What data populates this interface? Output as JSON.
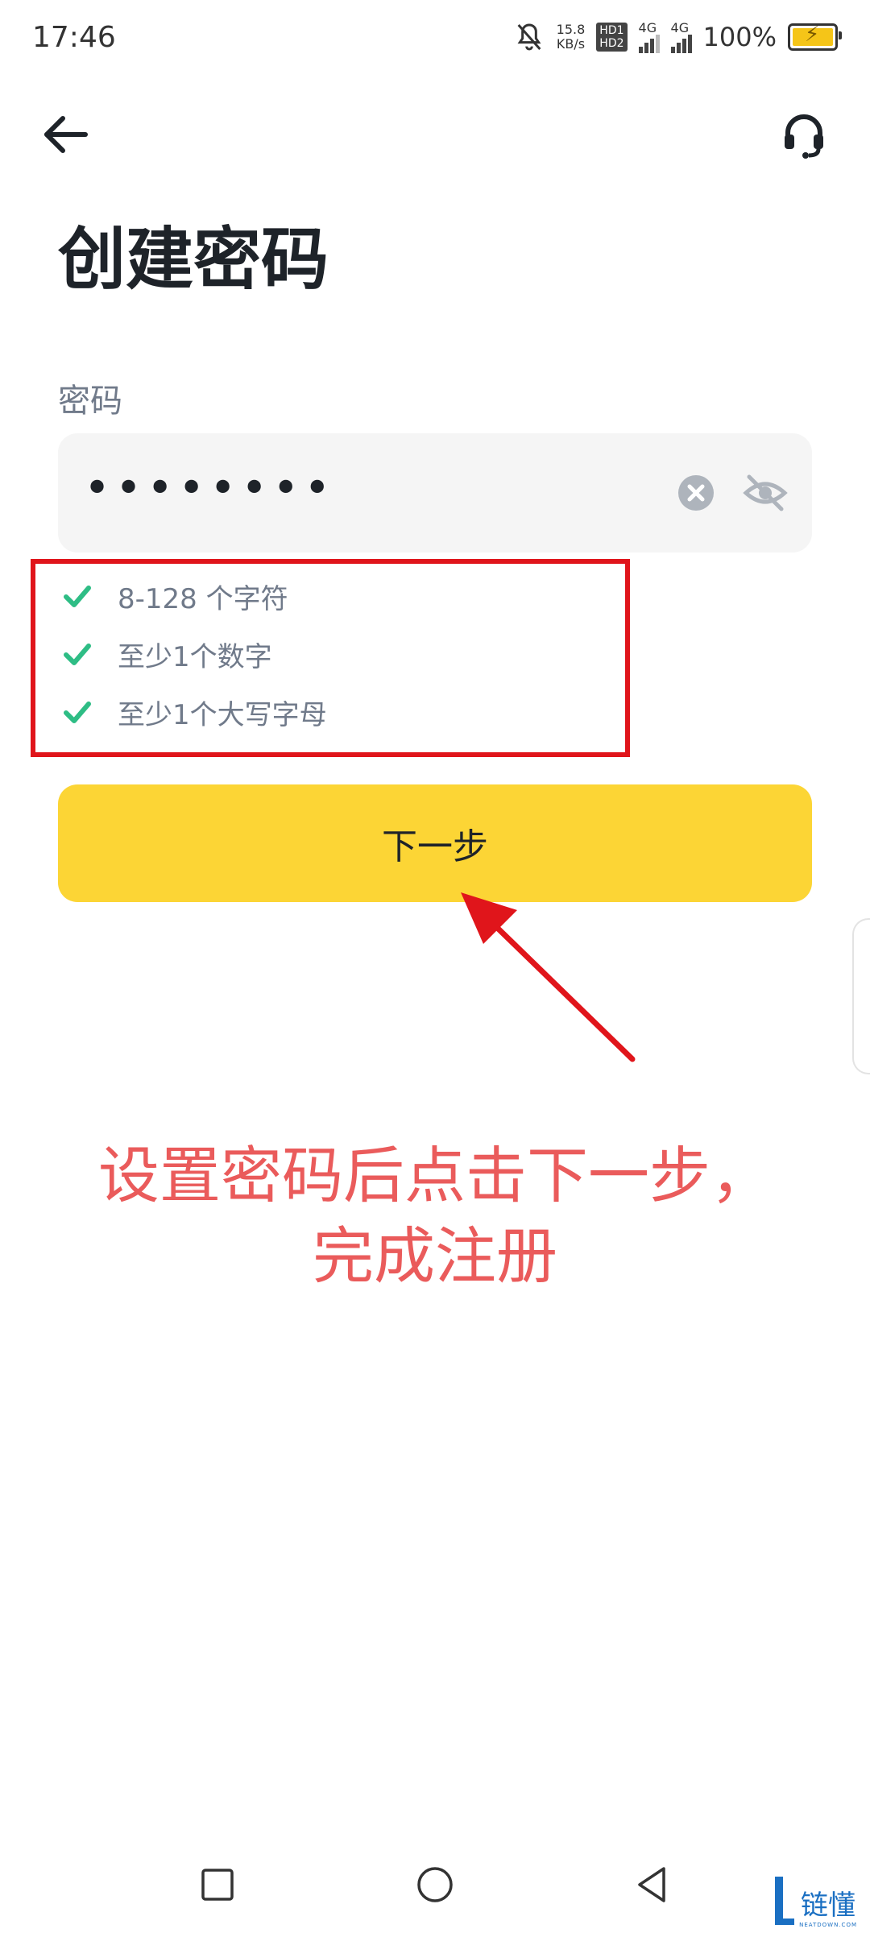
{
  "status_bar": {
    "time": "17:46",
    "net_speed_value": "15.8",
    "net_speed_unit": "KB/s",
    "hd1": "HD1",
    "hd2": "HD2",
    "net1": "4G",
    "net2": "4G",
    "battery": "100%",
    "battery_level": 1.0
  },
  "header": {
    "back_icon": "arrow-left-icon",
    "support_icon": "headset-icon"
  },
  "page": {
    "title": "创建密码"
  },
  "password": {
    "label": "密码",
    "value": "••••••••"
  },
  "requirements": [
    {
      "text": "8-128 个字符",
      "met": true
    },
    {
      "text": "至少1个数字",
      "met": true
    },
    {
      "text": "至少1个大写字母",
      "met": true
    }
  ],
  "next_button": {
    "label": "下一步"
  },
  "annotation": {
    "line1": "设置密码后点击下一步，",
    "line2": "完成注册"
  },
  "watermark": {
    "cn": "链懂",
    "en": "NEATDOWN.COM"
  },
  "colors": {
    "accent": "#fcd535",
    "check": "#2ebd85",
    "annotation": "#ea5b5b",
    "frame": "#e0151b"
  }
}
